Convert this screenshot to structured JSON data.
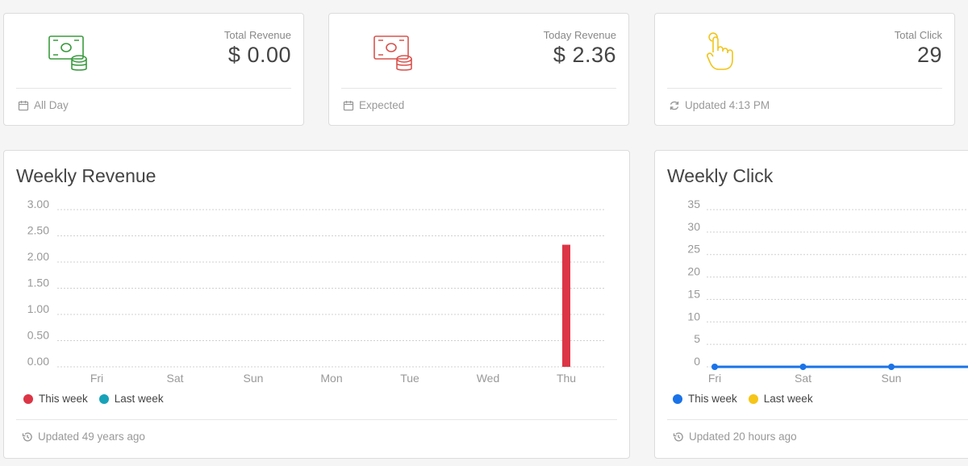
{
  "stats": [
    {
      "label": "Total Revenue",
      "value": "$ 0.00",
      "footer": "All Day",
      "icon": "money-coins-icon",
      "footer_icon": "calendar-icon",
      "color": "#3a9b3e"
    },
    {
      "label": "Today Revenue",
      "value": "$ 2.36",
      "footer": "Expected",
      "icon": "money-coins-icon",
      "footer_icon": "calendar-icon",
      "color": "#d9534f"
    },
    {
      "label": "Total Click",
      "value": "29",
      "footer": "Updated 4:13 PM",
      "icon": "pointer-hand-icon",
      "footer_icon": "refresh-icon",
      "color": "#f0c419"
    }
  ],
  "weekly_revenue": {
    "title": "Weekly Revenue",
    "footer": "Updated 49 years ago",
    "legend": [
      {
        "name": "This week",
        "color": "#dc3545"
      },
      {
        "name": "Last week",
        "color": "#17a2b8"
      }
    ]
  },
  "weekly_click": {
    "title": "Weekly Click",
    "footer": "Updated 20 hours ago",
    "legend": [
      {
        "name": "This week",
        "color": "#1a73e8"
      },
      {
        "name": "Last week",
        "color": "#f5c518"
      }
    ]
  },
  "chart_data": [
    {
      "type": "bar",
      "title": "Weekly Revenue",
      "categories": [
        "Fri",
        "Sat",
        "Sun",
        "Mon",
        "Tue",
        "Wed",
        "Thu"
      ],
      "series": [
        {
          "name": "This week",
          "color": "#dc3545",
          "values": [
            0,
            0,
            0,
            0,
            0,
            0,
            2.33
          ]
        },
        {
          "name": "Last week",
          "color": "#17a2b8",
          "values": [
            0,
            0,
            0,
            0,
            0,
            0,
            0
          ]
        }
      ],
      "yticks": [
        "0.00",
        "0.50",
        "1.00",
        "1.50",
        "2.00",
        "2.50",
        "3.00"
      ],
      "ylim": [
        0,
        3
      ],
      "grid": true,
      "legend": "bottom-left"
    },
    {
      "type": "line",
      "title": "Weekly Click",
      "categories": [
        "Fri",
        "Sat",
        "Sun"
      ],
      "series": [
        {
          "name": "This week",
          "color": "#1a73e8",
          "values": [
            0,
            0,
            0
          ]
        },
        {
          "name": "Last week",
          "color": "#f5c518",
          "values": [
            0,
            0,
            0
          ]
        }
      ],
      "yticks": [
        "0",
        "5",
        "10",
        "15",
        "20",
        "25",
        "30",
        "35"
      ],
      "ylim": [
        0,
        35
      ],
      "grid": true,
      "legend": "bottom-left"
    }
  ]
}
